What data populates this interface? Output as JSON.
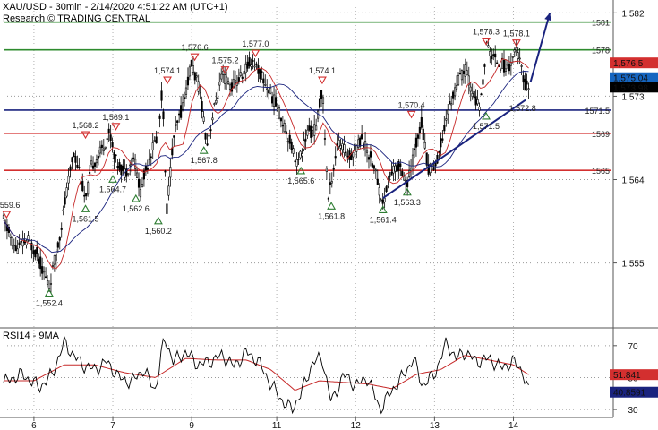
{
  "chart_data": [
    {
      "type": "candlestick",
      "header": {
        "line1": "XAU/USD - 30min - 2/14/2020 4:51:22 AM (UTC+1)",
        "line2": "Research © TRADING CENTRAL"
      },
      "ylim": [
        1548,
        1583
      ],
      "y_ticks": [
        "1,582",
        "1,573",
        "1,564",
        "1,555"
      ],
      "y_tick_values": [
        1582,
        1573,
        1564,
        1555
      ],
      "x_ticks": [
        "6",
        "7",
        "9",
        "11",
        "12",
        "13",
        "14"
      ],
      "x_tick_positions": [
        0.05,
        0.18,
        0.31,
        0.45,
        0.58,
        0.71,
        0.84
      ],
      "price_path": [
        [
          0.0,
          1559.6
        ],
        [
          0.02,
          1556.5
        ],
        [
          0.04,
          1557.5
        ],
        [
          0.055,
          1556.0
        ],
        [
          0.075,
          1552.4
        ],
        [
          0.09,
          1557.0
        ],
        [
          0.105,
          1563.0
        ],
        [
          0.115,
          1567.0
        ],
        [
          0.125,
          1565.0
        ],
        [
          0.135,
          1561.5
        ],
        [
          0.145,
          1565.5
        ],
        [
          0.16,
          1567.0
        ],
        [
          0.175,
          1569.1
        ],
        [
          0.185,
          1566.0
        ],
        [
          0.2,
          1564.7
        ],
        [
          0.215,
          1566.5
        ],
        [
          0.225,
          1562.6
        ],
        [
          0.24,
          1566.5
        ],
        [
          0.255,
          1569.0
        ],
        [
          0.262,
          1574.1
        ],
        [
          0.268,
          1560.2
        ],
        [
          0.28,
          1568.5
        ],
        [
          0.295,
          1572.0
        ],
        [
          0.31,
          1576.6
        ],
        [
          0.325,
          1573.0
        ],
        [
          0.335,
          1567.8
        ],
        [
          0.35,
          1572.5
        ],
        [
          0.36,
          1575.2
        ],
        [
          0.375,
          1574.0
        ],
        [
          0.39,
          1575.0
        ],
        [
          0.41,
          1577.0
        ],
        [
          0.43,
          1574.5
        ],
        [
          0.45,
          1572.0
        ],
        [
          0.47,
          1568.5
        ],
        [
          0.485,
          1565.6
        ],
        [
          0.5,
          1569.0
        ],
        [
          0.515,
          1569.5
        ],
        [
          0.525,
          1574.1
        ],
        [
          0.535,
          1561.8
        ],
        [
          0.55,
          1568.0
        ],
        [
          0.57,
          1566.5
        ],
        [
          0.59,
          1568.5
        ],
        [
          0.61,
          1565.5
        ],
        [
          0.625,
          1561.4
        ],
        [
          0.64,
          1565.0
        ],
        [
          0.655,
          1565.5
        ],
        [
          0.665,
          1563.3
        ],
        [
          0.68,
          1568.0
        ],
        [
          0.688,
          1570.4
        ],
        [
          0.7,
          1565.0
        ],
        [
          0.715,
          1566.0
        ],
        [
          0.73,
          1571.0
        ],
        [
          0.745,
          1574.0
        ],
        [
          0.76,
          1576.0
        ],
        [
          0.775,
          1573.0
        ],
        [
          0.785,
          1571.5
        ],
        [
          0.795,
          1578.3
        ],
        [
          0.81,
          1577.0
        ],
        [
          0.83,
          1576.0
        ],
        [
          0.845,
          1578.1
        ],
        [
          0.86,
          1574.0
        ],
        [
          0.865,
          1573.98
        ]
      ],
      "swing_highs": [
        {
          "x": 0.005,
          "v": 1559.6,
          "label": "1,559.6"
        },
        {
          "x": 0.135,
          "v": 1568.2,
          "label": "1,568.2"
        },
        {
          "x": 0.185,
          "v": 1569.1,
          "label": "1,569.1"
        },
        {
          "x": 0.27,
          "v": 1574.1,
          "label": "1,574.1"
        },
        {
          "x": 0.315,
          "v": 1576.6,
          "label": "1,576.6"
        },
        {
          "x": 0.365,
          "v": 1575.2,
          "label": "1,575.2"
        },
        {
          "x": 0.415,
          "v": 1577.0,
          "label": "1,577.0"
        },
        {
          "x": 0.525,
          "v": 1574.1,
          "label": "1,574.1"
        },
        {
          "x": 0.672,
          "v": 1570.4,
          "label": "1,570.4"
        },
        {
          "x": 0.795,
          "v": 1578.3,
          "label": "1,578.3"
        },
        {
          "x": 0.845,
          "v": 1578.1,
          "label": "1,578.1"
        }
      ],
      "swing_lows": [
        {
          "x": 0.075,
          "v": 1552.4,
          "label": "1,552.4"
        },
        {
          "x": 0.135,
          "v": 1561.5,
          "label": "1,561.5"
        },
        {
          "x": 0.18,
          "v": 1564.7,
          "label": "1,564.7"
        },
        {
          "x": 0.218,
          "v": 1562.6,
          "label": "1,562.6"
        },
        {
          "x": 0.255,
          "v": 1560.2,
          "label": "1,560.2"
        },
        {
          "x": 0.33,
          "v": 1567.8,
          "label": "1,567.8"
        },
        {
          "x": 0.49,
          "v": 1565.6,
          "label": "1,565.6"
        },
        {
          "x": 0.54,
          "v": 1561.8,
          "label": "1,561.8"
        },
        {
          "x": 0.625,
          "v": 1561.4,
          "label": "1,561.4"
        },
        {
          "x": 0.665,
          "v": 1563.3,
          "label": "1,563.3"
        },
        {
          "x": 0.795,
          "v": 1571.5,
          "label": "1,571.5"
        }
      ],
      "levels": [
        {
          "value": 1581,
          "label": "1581",
          "color": "#2e8b2e"
        },
        {
          "value": 1578,
          "label": "1578",
          "color": "#2e8b2e"
        },
        {
          "value": 1571.5,
          "label": "1571.5",
          "color": "#1a237e"
        },
        {
          "value": 1569,
          "label": "1569",
          "color": "#d32f2f"
        },
        {
          "value": 1565,
          "label": "1565",
          "color": "#d32f2f"
        }
      ],
      "point_labels": [
        {
          "x": 0.855,
          "v": 1571.4,
          "label": "1,572.8"
        }
      ],
      "trendline": [
        [
          0.625,
          1562.0
        ],
        [
          0.86,
          1572.6
        ]
      ],
      "projection_arrow": [
        [
          0.868,
          1574.5
        ],
        [
          0.9,
          1582.0
        ]
      ],
      "price_badges": [
        {
          "value": 1576.6,
          "label": "1,576.5",
          "bg": "#d32f2f",
          "fg": "#ffffff"
        },
        {
          "value": 1575.0,
          "label": "1,575.04",
          "bg": "#1565c0",
          "fg": "#ffffff"
        },
        {
          "value": 1573.98,
          "label": "1,573.98",
          "bg": "#000000",
          "fg": "#ffffff"
        }
      ],
      "colors": {
        "candle": "#000000",
        "ma_fast": "#c62828",
        "ma_slow": "#1a237e",
        "arrow": "#1a237e"
      }
    },
    {
      "type": "line",
      "title": "RSI14 - 9MA",
      "ylim": [
        25,
        80
      ],
      "y_ticks": [
        "70",
        "50",
        "30"
      ],
      "y_tick_values": [
        70,
        50,
        30
      ],
      "rsi_path": [
        [
          0.0,
          47
        ],
        [
          0.03,
          52
        ],
        [
          0.06,
          44
        ],
        [
          0.08,
          52
        ],
        [
          0.1,
          72
        ],
        [
          0.115,
          64
        ],
        [
          0.13,
          58
        ],
        [
          0.15,
          55
        ],
        [
          0.17,
          60
        ],
        [
          0.19,
          50
        ],
        [
          0.21,
          47
        ],
        [
          0.23,
          55
        ],
        [
          0.25,
          42
        ],
        [
          0.265,
          75
        ],
        [
          0.28,
          60
        ],
        [
          0.3,
          66
        ],
        [
          0.32,
          58
        ],
        [
          0.34,
          60
        ],
        [
          0.36,
          64
        ],
        [
          0.38,
          57
        ],
        [
          0.4,
          66
        ],
        [
          0.42,
          60
        ],
        [
          0.44,
          46
        ],
        [
          0.46,
          35
        ],
        [
          0.475,
          30
        ],
        [
          0.49,
          40
        ],
        [
          0.51,
          60
        ],
        [
          0.525,
          62
        ],
        [
          0.54,
          34
        ],
        [
          0.56,
          52
        ],
        [
          0.58,
          45
        ],
        [
          0.6,
          50
        ],
        [
          0.62,
          30
        ],
        [
          0.64,
          42
        ],
        [
          0.66,
          52
        ],
        [
          0.675,
          62
        ],
        [
          0.69,
          45
        ],
        [
          0.71,
          52
        ],
        [
          0.73,
          72
        ],
        [
          0.745,
          62
        ],
        [
          0.76,
          66
        ],
        [
          0.78,
          60
        ],
        [
          0.8,
          62
        ],
        [
          0.82,
          56
        ],
        [
          0.84,
          60
        ],
        [
          0.855,
          54
        ],
        [
          0.865,
          40.86
        ]
      ],
      "ma_path": [
        [
          0.0,
          48
        ],
        [
          0.05,
          48
        ],
        [
          0.1,
          58
        ],
        [
          0.15,
          58
        ],
        [
          0.2,
          53
        ],
        [
          0.25,
          50
        ],
        [
          0.3,
          62
        ],
        [
          0.35,
          61
        ],
        [
          0.4,
          61
        ],
        [
          0.44,
          55
        ],
        [
          0.48,
          42
        ],
        [
          0.52,
          48
        ],
        [
          0.56,
          47
        ],
        [
          0.6,
          46
        ],
        [
          0.64,
          43
        ],
        [
          0.68,
          52
        ],
        [
          0.72,
          55
        ],
        [
          0.76,
          64
        ],
        [
          0.8,
          61
        ],
        [
          0.84,
          58
        ],
        [
          0.865,
          51.84
        ]
      ],
      "badges": [
        {
          "value": 51.84,
          "label": "51.841",
          "bg": "#d32f2f",
          "fg": "#ffffff"
        },
        {
          "value": 40.86,
          "label": "40.8591",
          "bg": "#1a237e",
          "fg": "#ffffff"
        }
      ],
      "colors": {
        "rsi": "#000000",
        "ma": "#c62828"
      }
    }
  ]
}
